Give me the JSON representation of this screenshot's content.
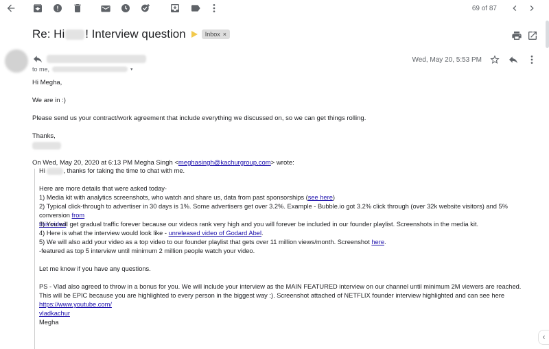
{
  "toolbar": {
    "back_icon": "arrow-left-icon",
    "icons": [
      "archive-icon",
      "report-spam-icon",
      "delete-icon",
      "mark-unread-icon",
      "snooze-icon",
      "add-to-tasks-icon",
      "move-to-icon",
      "label-icon",
      "more-vert-icon"
    ],
    "pager": "69 of 87"
  },
  "subject": {
    "prefix": "Re: Hi",
    "suffix": "! Interview question",
    "label": "Inbox"
  },
  "sender": {
    "to_prefix": "to me,",
    "date": "Wed, May 20, 5:53 PM"
  },
  "message": {
    "greeting": "Hi Megha,",
    "line1": "We are in :)",
    "line2": "Please send us your contract/work agreement that include everything we discussed on, so we can get things rolling.",
    "signoff": "Thanks,"
  },
  "quoted": {
    "header_prefix": "On Wed, May 20, 2020 at 6:13 PM Megha Singh <",
    "header_email": "meghasingh@kachurgroup.com",
    "header_suffix": "> wrote:",
    "hi": "Hi",
    "hi_rest": ", thanks for taking the time to chat with me.",
    "intro": "Here are more details that were asked today-",
    "item1": "1) Media kit with analytics screenshots, who watch and share us, data from past sponsorships (",
    "item1_link": "see here",
    "item1_end": ")",
    "item2": "2) Typical click-through to advertiser in 30 days is 1%. Some advertisers get over 3.2%. Example - Bubble.io got 3.2% click through (over 32k website visitors) and 5% conversion ",
    "item2_link_a": "from",
    "item2_link_b": "this video",
    "item2_end": ".",
    "item3": "3) You will get gradual traffic forever because our videos rank very high and you will forever be included in our founder playlist. Screenshots in the media kit.",
    "item4": "4) Here is what the interview would look like - ",
    "item4_link": "unreleased video of Godard Abel",
    "item4_end": ".",
    "item5": "5) We will also add your video as a top video to our founder playlist that gets over 11 million views/month. Screenshot ",
    "item5_link": "here",
    "item5_end": ".",
    "item6": "-featured as top 5 interview until minimum 2 million people watch your video.",
    "questions": "Let me know if you have any questions.",
    "ps": "PS - Vlad also agreed to throw in a bonus for you. We will include your interview as the MAIN FEATURED interview on our channel until minimum 2M viewers are reached. This will be EPIC because you are highlighted to every person in the biggest way :). Screenshot attached of NETFLIX founder interview highlighted and can see here ",
    "ps_link_a": "https://www.youtube.com/",
    "ps_link_b": "vladkachur",
    "sig": "Megha"
  }
}
